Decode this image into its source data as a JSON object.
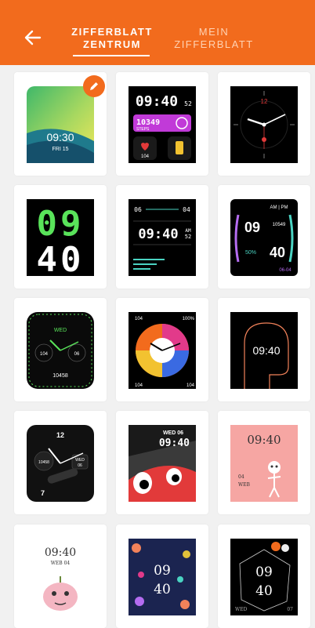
{
  "header": {
    "back_icon": "arrow-left-icon",
    "tabs": [
      {
        "line1": "ZIFFERBLATT",
        "line2": "ZENTRUM",
        "active": true
      },
      {
        "line1": "MEIN",
        "line2": "ZIFFERBLATT",
        "active": false
      }
    ]
  },
  "colors": {
    "accent": "#f26b1d",
    "background": "#f1f1f1",
    "card": "#ffffff"
  },
  "faces": {
    "f1": {
      "time": "09:30",
      "date": "FRI 15"
    },
    "f2": {
      "time": "09:40",
      "seconds": "52",
      "steps": "10349",
      "steps_label": "STEPS",
      "heart": "104"
    },
    "f3": {
      "twelve": "12"
    },
    "f4": {
      "hour": "09",
      "minute": "40"
    },
    "f5": {
      "left_num": "06",
      "right_num": "04",
      "time": "09:40",
      "seconds": "52",
      "ampm": "AM"
    },
    "f6": {
      "hour": "09",
      "minute": "40",
      "ampm": "AM | PM",
      "steps": "10549",
      "percent": "50%",
      "date": "06-04"
    },
    "f7": {
      "day": "WED",
      "left": "104",
      "right": "06",
      "bottom": "10458"
    },
    "f8": {
      "left_top": "104",
      "right_top": "100%",
      "bottom_left": "104",
      "bottom_right": "104"
    },
    "f9": {
      "time": "09:40"
    },
    "f10": {
      "twelve": "12",
      "left": "10458",
      "day": "WED",
      "date": "06",
      "seven": "7"
    },
    "f11": {
      "day_date": "WED 06",
      "time": "09:40"
    },
    "f12": {
      "time": "09:40",
      "day": "WEB",
      "date": "04"
    },
    "f13": {
      "time": "09:40",
      "day": "WEB 04"
    },
    "f14": {
      "hour": "09",
      "minute": "40"
    },
    "f15": {
      "hour": "09",
      "minute": "40",
      "day": "WED",
      "date": "07"
    }
  }
}
